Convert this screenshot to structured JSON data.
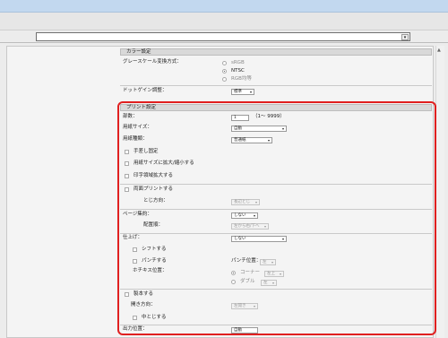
{
  "color_section": {
    "title": "カラー設定",
    "grayscale_label": "グレースケール変換方式：",
    "grayscale_options": [
      "sRGB",
      "NTSC",
      "RGB均等"
    ],
    "grayscale_selected": "NTSC",
    "dot_gain_label": "ドットゲイン調整：",
    "dot_gain_value": "標準"
  },
  "print_section": {
    "title": "プリント設定",
    "copies_label": "部数：",
    "copies_value": "1",
    "copies_range": "（1～ 9999）",
    "paper_size_label": "用紙サイズ：",
    "paper_size_value": "自動",
    "paper_type_label": "用紙種類：",
    "paper_type_value": "普通紙",
    "manual_feed_label": "手差し固定",
    "scale_to_paper_label": "用紙サイズに拡大/縮小する",
    "print_area_label": "印字領域拡大する",
    "duplex_label": "両面プリントする",
    "binding_label": "とじ方向：",
    "binding_value": "長辺とじ",
    "page_layout_label": "ページ集約：",
    "page_layout_value": "しない",
    "page_order_label": "配置順：",
    "page_order_value": "左から右/下へ",
    "finishing_label": "仕上げ：",
    "finishing_value": "しない",
    "shift_label": "シフトする",
    "punch_label": "パンチする",
    "punch_position_label": "パンチ位置：",
    "punch_position_value": "左",
    "staple_position_label": "ホチキス位置：",
    "staple_corner_label": "コーナー",
    "staple_corner_value": "左上",
    "staple_double_label": "ダブル",
    "staple_double_value": "左",
    "booklet_label": "製本する",
    "opening_label": "開き方向：",
    "opening_value": "左開き",
    "saddle_label": "中とじする",
    "output_label": "出力位置：",
    "output_value": "自動"
  }
}
